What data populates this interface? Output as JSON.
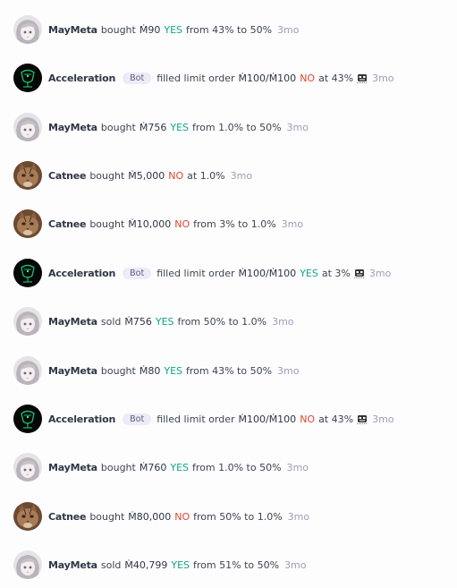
{
  "rows": [
    {
      "user": "MayMeta",
      "avatar": "anime-avatar",
      "text1": "bought",
      "amount": "Ṁ90",
      "outcome": "YES",
      "outcome_type": "yes",
      "text2": "from 43% to 50%",
      "time": "3mo"
    },
    {
      "user": "Acceleration",
      "avatar": "bot-avatar",
      "badge": "Bot",
      "text1": "filled limit order",
      "amount": "Ṁ100/Ṁ100",
      "outcome": "NO",
      "outcome_type": "no",
      "text2": "at 43%",
      "time": "3mo",
      "icon": "robot-icon"
    },
    {
      "user": "MayMeta",
      "avatar": "anime-avatar",
      "text1": "bought",
      "amount": "Ṁ756",
      "outcome": "YES",
      "outcome_type": "yes",
      "text2": "from 1.0% to 50%",
      "time": "3mo"
    },
    {
      "user": "Catnee",
      "avatar": "cat-avatar",
      "text1": "bought",
      "amount": "Ṁ5,000",
      "outcome": "NO",
      "outcome_type": "no",
      "text2": "at 1.0%",
      "time": "3mo"
    },
    {
      "user": "Catnee",
      "avatar": "cat-avatar",
      "text1": "bought",
      "amount": "Ṁ10,000",
      "outcome": "NO",
      "outcome_type": "no",
      "text2": "from 3% to 1.0%",
      "time": "3mo"
    },
    {
      "user": "Acceleration",
      "avatar": "bot-avatar",
      "badge": "Bot",
      "text1": "filled limit order",
      "amount": "Ṁ100/Ṁ100",
      "outcome": "YES",
      "outcome_type": "yes",
      "text2": "at 3%",
      "time": "3mo",
      "icon": "robot-icon"
    },
    {
      "user": "MayMeta",
      "avatar": "anime-avatar",
      "text1": "sold",
      "amount": "Ṁ756",
      "outcome": "YES",
      "outcome_type": "yes",
      "text2": "from 50% to 1.0%",
      "time": "3mo"
    },
    {
      "user": "MayMeta",
      "avatar": "anime-avatar",
      "text1": "bought",
      "amount": "Ṁ80",
      "outcome": "YES",
      "outcome_type": "yes",
      "text2": "from 43% to 50%",
      "time": "3mo"
    },
    {
      "user": "Acceleration",
      "avatar": "bot-avatar",
      "badge": "Bot",
      "text1": "filled limit order",
      "amount": "Ṁ100/Ṁ100",
      "outcome": "NO",
      "outcome_type": "no",
      "text2": "at 43%",
      "time": "3mo",
      "icon": "robot-icon"
    },
    {
      "user": "MayMeta",
      "avatar": "anime-avatar",
      "text1": "bought",
      "amount": "Ṁ760",
      "outcome": "YES",
      "outcome_type": "yes",
      "text2": "from 1.0% to 50%",
      "time": "3mo"
    },
    {
      "user": "Catnee",
      "avatar": "cat-avatar",
      "text1": "bought",
      "amount": "Ṁ80,000",
      "outcome": "NO",
      "outcome_type": "no",
      "text2": "from 50% to 1.0%",
      "time": "3mo"
    },
    {
      "user": "MayMeta",
      "avatar": "anime-avatar",
      "text1": "sold",
      "amount": "Ṁ40,799",
      "outcome": "YES",
      "outcome_type": "yes",
      "text2": "from 51% to 50%",
      "time": "3mo"
    }
  ],
  "colors": {
    "yes": "#14a38b",
    "no": "#e2462f",
    "time": "#9aa0b4",
    "badge_bg": "#ecebf7"
  }
}
